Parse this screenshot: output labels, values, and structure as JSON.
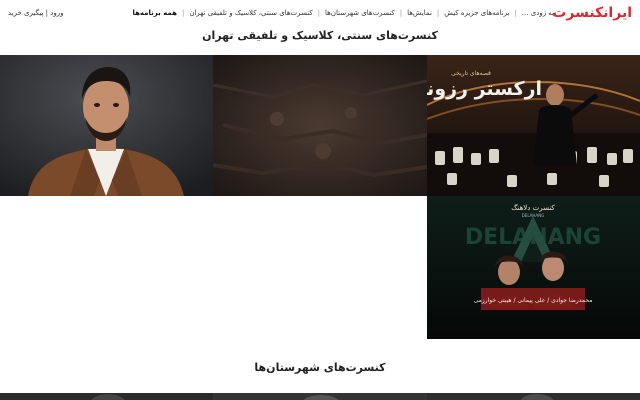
{
  "header": {
    "logo": "ایرانکنسرت",
    "nav": [
      {
        "label": "همه برنامه‌ها",
        "active": true
      },
      {
        "label": "کنسرت‌های سنتی، کلاسیک و تلفیقی تهران",
        "active": false
      },
      {
        "label": "کنسرت‌های شهرستان‌ها",
        "active": false
      },
      {
        "label": "نمایش‌ها",
        "active": false
      },
      {
        "label": "برنامه‌های جزیره کیش",
        "active": false
      },
      {
        "label": "به زودی ...",
        "active": false
      }
    ],
    "login": "ورود | پیگیری خرید"
  },
  "sections": {
    "tehran_title": "کنسرت‌های سنتی، کلاسیک و تلفیقی تهران",
    "provinces_title": "کنسرت‌های شهرستان‌ها"
  },
  "posters": {
    "orchestra_title": "ارکستر رزونیک",
    "orchestra_subtitle": "قصه‌های تاریخی",
    "delahang_small": "کنسرت دلاهنگ",
    "delahang_latin": "DELAHANG",
    "delahang_big": "DELAHANG",
    "delahang_names": "محمدرضا جوادی / علی پیمانی / هیبتی خوارزمی"
  },
  "colors": {
    "brand": "#e3262d",
    "tile_a_bg": "#2c2e31",
    "tile_b_bg": "#2b2420",
    "tile_c_bg": "#16100c",
    "tile_d_bg": "#0b1410"
  }
}
